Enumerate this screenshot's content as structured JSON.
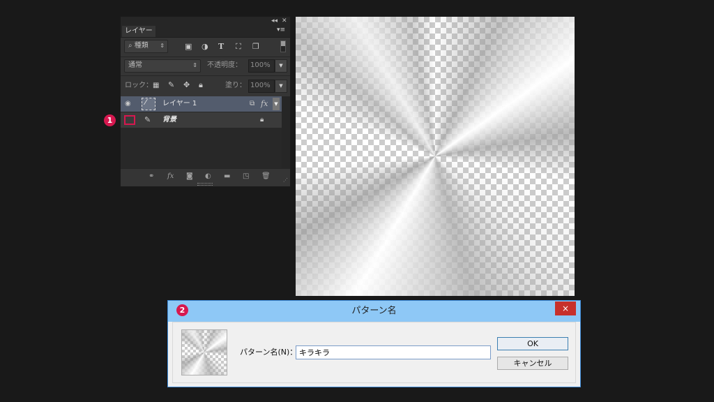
{
  "layers_panel": {
    "collapse_icon": "double-chevron-left-icon",
    "close_icon": "close-icon",
    "tab_label": "レイヤー",
    "filter_kind": "種類",
    "blend_mode": "通常",
    "opacity_label": "不透明度：",
    "opacity_value": "100%",
    "lock_label": "ロック：",
    "fill_label": "塗り：",
    "fill_value": "100%",
    "layers": [
      {
        "name": "レイヤー 1",
        "selected": true,
        "visible": true
      },
      {
        "name": "背景",
        "selected": false,
        "visible": false,
        "locked": true
      }
    ]
  },
  "badges": [
    "1",
    "2"
  ],
  "dialog": {
    "title": "パターン名",
    "close_glyph": "×",
    "name_label": "パターン名(N)：",
    "name_value": "キラキラ",
    "ok_label": "OK",
    "cancel_label": "キャンセル"
  },
  "colors": {
    "badge": "#d6184f",
    "dialog_titlebar": "#8ec8f6",
    "selected_layer": "#535c6d"
  }
}
